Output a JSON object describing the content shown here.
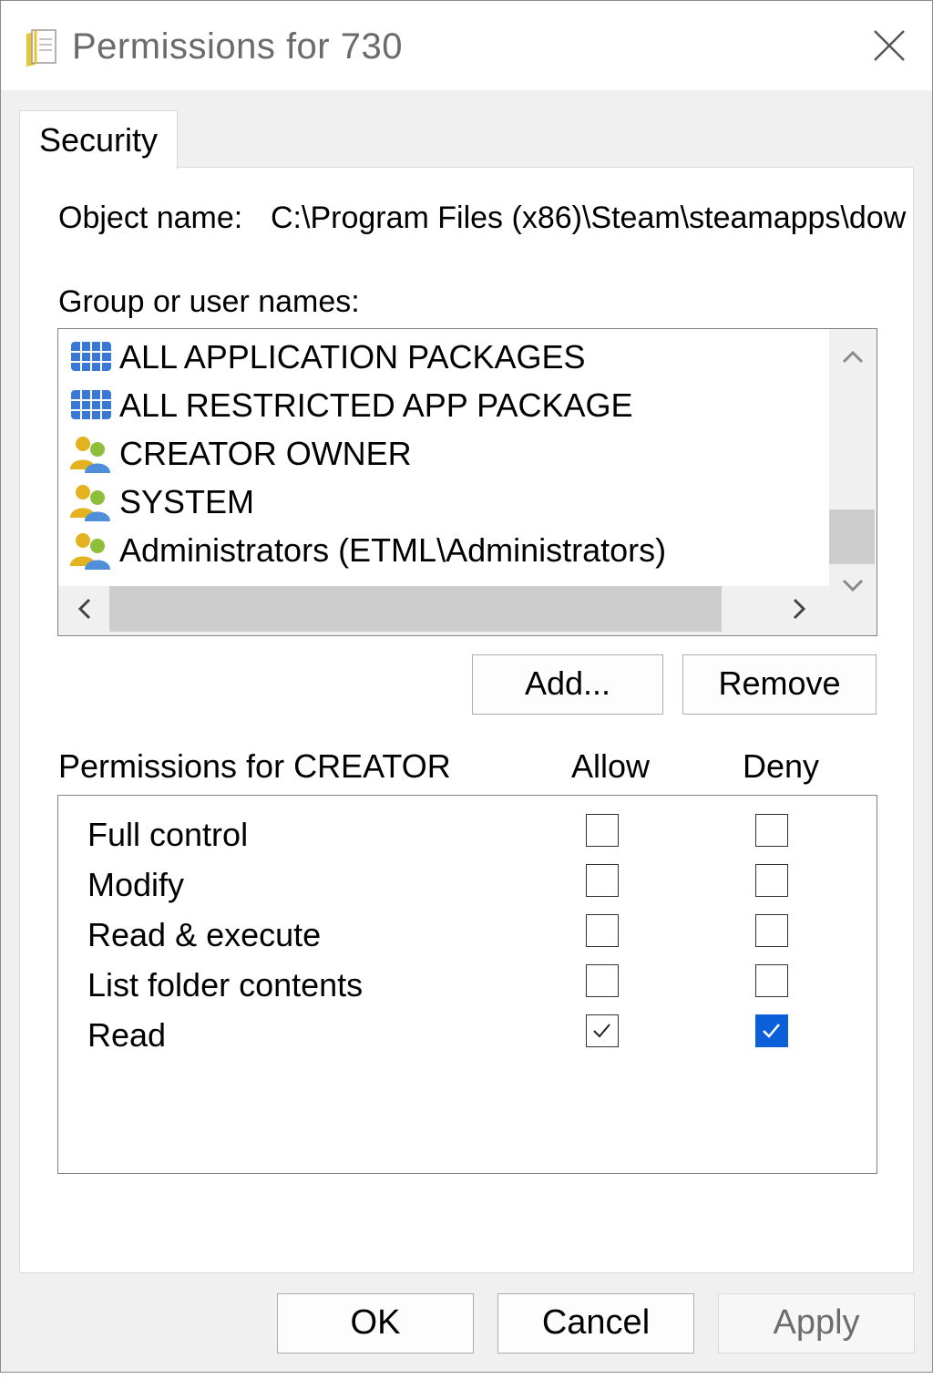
{
  "window": {
    "title": "Permissions for 730",
    "icon": "document-icon",
    "close_icon": "close-icon"
  },
  "tabs": [
    {
      "label": "Security",
      "active": true
    }
  ],
  "object": {
    "label": "Object name:",
    "value": "C:\\Program Files (x86)\\Steam\\steamapps\\dow"
  },
  "groups": {
    "label": "Group or user names:",
    "items": [
      {
        "label": "ALL APPLICATION PACKAGES",
        "icon": "app-packages-icon"
      },
      {
        "label": "ALL RESTRICTED APP PACKAGE",
        "icon": "app-packages-icon"
      },
      {
        "label": "CREATOR OWNER",
        "icon": "users-icon"
      },
      {
        "label": "SYSTEM",
        "icon": "users-icon"
      },
      {
        "label": "Administrators (ETML\\Administrators)",
        "icon": "users-icon"
      }
    ]
  },
  "buttons": {
    "add": "Add...",
    "remove": "Remove",
    "ok": "OK",
    "cancel": "Cancel",
    "apply": "Apply"
  },
  "permissions": {
    "header": "Permissions for CREATOR",
    "allow_label": "Allow",
    "deny_label": "Deny",
    "rows": [
      {
        "name": "Full control",
        "allow": false,
        "deny": false
      },
      {
        "name": "Modify",
        "allow": false,
        "deny": false
      },
      {
        "name": "Read & execute",
        "allow": false,
        "deny": false
      },
      {
        "name": "List folder contents",
        "allow": false,
        "deny": false
      },
      {
        "name": "Read",
        "allow": true,
        "deny": true
      }
    ]
  },
  "colors": {
    "accent": "#0b5fd8",
    "window_bg": "#f0f0f0",
    "scroll_thumb": "#cdcdcd"
  }
}
